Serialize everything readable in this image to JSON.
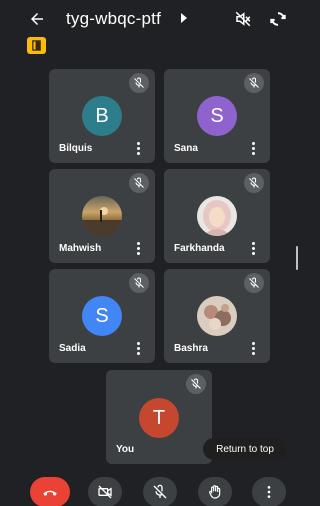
{
  "header": {
    "meeting_code": "tyg-wbqc-ptf"
  },
  "colors": {
    "background": "#202124",
    "tile": "#3c4043",
    "end_call": "#ea4335",
    "room_badge": "#fbbc04"
  },
  "participants": [
    {
      "name": "Bilquis",
      "initial": "B",
      "avatar_color": "#2e7d8c",
      "muted": true
    },
    {
      "name": "Sana",
      "initial": "S",
      "avatar_color": "#8e63ce",
      "muted": true
    },
    {
      "name": "Mahwish",
      "initial": "",
      "avatar": "photo-sunset",
      "muted": true
    },
    {
      "name": "Farkhanda",
      "initial": "",
      "avatar": "photo-portrait",
      "muted": true
    },
    {
      "name": "Sadia",
      "initial": "S",
      "avatar_color": "#4285f4",
      "muted": true
    },
    {
      "name": "Bashra",
      "initial": "",
      "avatar": "photo-flowers",
      "muted": true
    },
    {
      "name": "You",
      "initial": "T",
      "avatar_color": "#c5472f",
      "muted": true
    }
  ],
  "return_to_top_label": "Return to top",
  "icons": {
    "back": "arrow-left-icon",
    "chevron": "chevron-right-icon",
    "speaker_off": "speaker-off-icon",
    "switch_camera": "switch-camera-icon",
    "room": "door-icon",
    "mic_off": "mic-off-icon",
    "more": "more-vert-icon",
    "end_call": "call-end-icon",
    "camera_off": "camera-off-icon",
    "hand": "hand-icon"
  }
}
